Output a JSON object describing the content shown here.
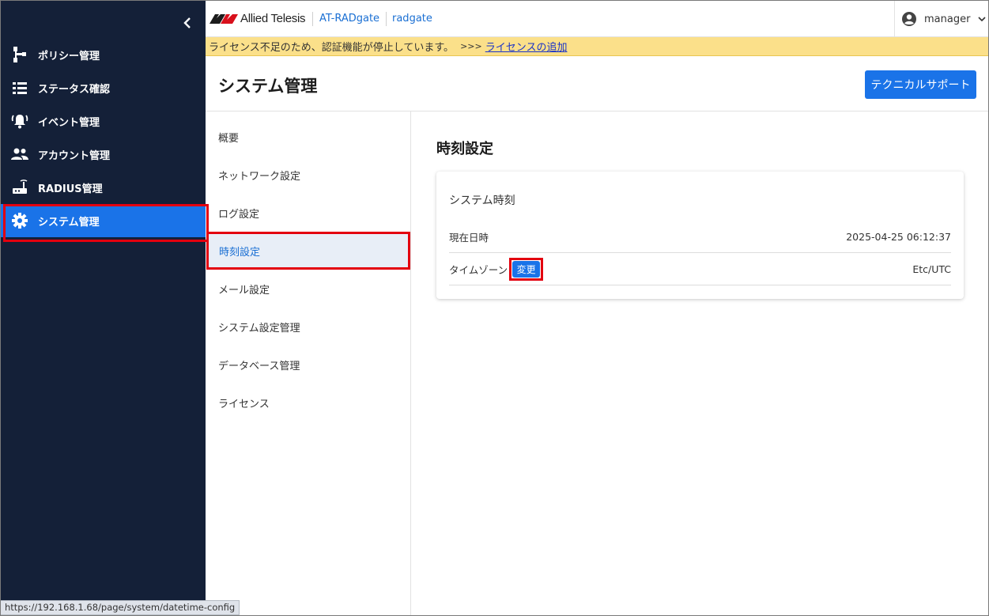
{
  "browser_status_url": "https://192.168.1.68/page/system/datetime-config",
  "header": {
    "brand": "Allied Telesis",
    "product": "AT-RADgate",
    "host": "radgate",
    "user": "manager"
  },
  "warning": {
    "message": "ライセンス不足のため、認証機能が停止しています。",
    "arrows": ">>>",
    "link": "ライセンスの追加"
  },
  "sidebar": {
    "items": [
      {
        "label": "ポリシー管理",
        "icon": "policy-tree-icon"
      },
      {
        "label": "ステータス確認",
        "icon": "list-icon"
      },
      {
        "label": "イベント管理",
        "icon": "bell-alert-icon"
      },
      {
        "label": "アカウント管理",
        "icon": "people-icon"
      },
      {
        "label": "RADIUS管理",
        "icon": "router-icon"
      },
      {
        "label": "システム管理",
        "icon": "gear-icon",
        "active": true
      }
    ]
  },
  "page": {
    "title": "システム管理",
    "tech_support_button": "テクニカルサポート"
  },
  "submenu": {
    "items": [
      {
        "label": "概要"
      },
      {
        "label": "ネットワーク設定"
      },
      {
        "label": "ログ設定"
      },
      {
        "label": "時刻設定",
        "active": true
      },
      {
        "label": "メール設定"
      },
      {
        "label": "システム設定管理"
      },
      {
        "label": "データベース管理"
      },
      {
        "label": "ライセンス"
      }
    ]
  },
  "content": {
    "title": "時刻設定",
    "card_title": "システム時刻",
    "rows": [
      {
        "label": "現在日時",
        "value": "2025-04-25 06:12:37"
      },
      {
        "label": "タイムゾーン",
        "value": "Etc/UTC",
        "button": "変更"
      }
    ]
  },
  "colors": {
    "sidebar_bg": "#142038",
    "accent": "#1a73e8",
    "warning_bg": "#fbe08a",
    "highlight_border": "#e3000f"
  }
}
